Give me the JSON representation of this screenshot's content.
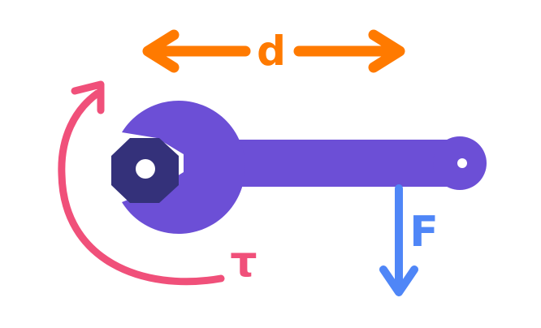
{
  "diagram": {
    "labels": {
      "distance": "d",
      "force": "F",
      "torque": "τ"
    },
    "colors": {
      "background": "#ffffff",
      "wrench": "#6c4fd6",
      "nut": "#34317a",
      "distance_arrow": "#ff7a00",
      "force_arrow": "#4f86f7",
      "torque_arrow": "#f0507a"
    }
  }
}
